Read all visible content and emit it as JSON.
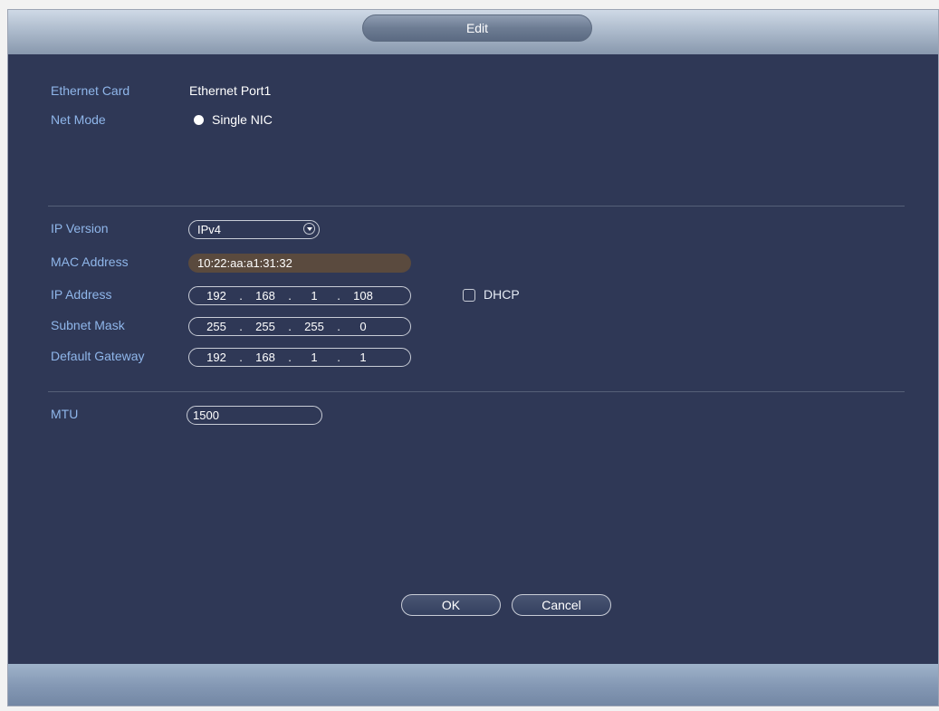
{
  "dialog": {
    "title": "Edit"
  },
  "ethernet_card": {
    "label": "Ethernet Card",
    "value": "Ethernet Port1"
  },
  "net_mode": {
    "label": "Net Mode",
    "option": "Single NIC"
  },
  "ip_version": {
    "label": "IP Version",
    "value": "IPv4"
  },
  "mac_address": {
    "label": "MAC Address",
    "value": "10:22:aa:a1:31:32"
  },
  "ip_address": {
    "label": "IP Address",
    "octets": [
      "192",
      "168",
      "1",
      "108"
    ]
  },
  "dhcp": {
    "label": "DHCP",
    "checked": false
  },
  "subnet_mask": {
    "label": "Subnet Mask",
    "octets": [
      "255",
      "255",
      "255",
      "0"
    ]
  },
  "default_gateway": {
    "label": "Default Gateway",
    "octets": [
      "192",
      "168",
      "1",
      "1"
    ]
  },
  "mtu": {
    "label": "MTU",
    "value": "1500"
  },
  "buttons": {
    "ok": "OK",
    "cancel": "Cancel"
  },
  "colors": {
    "panel_bg": "#2f3856",
    "label_blue": "#8fb6ea",
    "accent_text": "#ffffff"
  },
  "icons": {
    "net_mode_radio": "radio-selected-icon",
    "dropdown": "chevron-down-icon",
    "dhcp": "checkbox-icon"
  }
}
